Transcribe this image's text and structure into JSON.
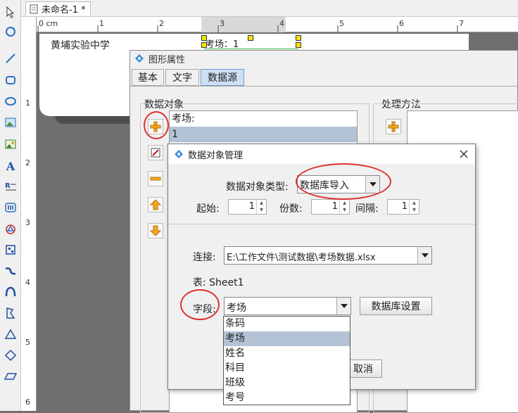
{
  "app": {
    "document_tab": "未命名-1 *"
  },
  "ruler": {
    "h_marks": [
      "0 cm",
      "1",
      "2",
      "3",
      "4",
      "5",
      "6",
      "7"
    ],
    "v_marks": [
      "1",
      "2",
      "3",
      "4",
      "5",
      "6"
    ]
  },
  "canvas": {
    "label_text": "黄埔实验中学",
    "selected_text": "考场：1"
  },
  "property_window": {
    "title": "图形属性",
    "tabs": [
      {
        "label": "基本"
      },
      {
        "label": "文字"
      },
      {
        "label": "数据源"
      }
    ],
    "data_objects_label": "数据对象",
    "processing_label": "处理方法",
    "data_items": [
      "考场:",
      "1"
    ]
  },
  "dialog": {
    "title": "数据对象管理",
    "type_label": "数据对象类型:",
    "type_value": "数据库导入",
    "start_label": "起始:",
    "start_value": "1",
    "copies_label": "份数:",
    "copies_value": "1",
    "interval_label": "间隔:",
    "interval_value": "1",
    "connection_label": "连接:",
    "connection_value": "E:\\工作文件\\测试数据\\考场数据.xlsx",
    "table_label": "表: Sheet1",
    "field_label": "字段:",
    "field_value": "考场",
    "db_settings_button": "数据库设置",
    "cancel_button": "取消",
    "field_options": [
      "条码",
      "考场",
      "姓名",
      "科目",
      "班级",
      "考号"
    ],
    "selected_option_index": 1
  },
  "colors": {
    "highlight_ellipse": "#e03030",
    "selected_row": "#b4c2d6",
    "canvas_bg": "#6f6f6f"
  }
}
